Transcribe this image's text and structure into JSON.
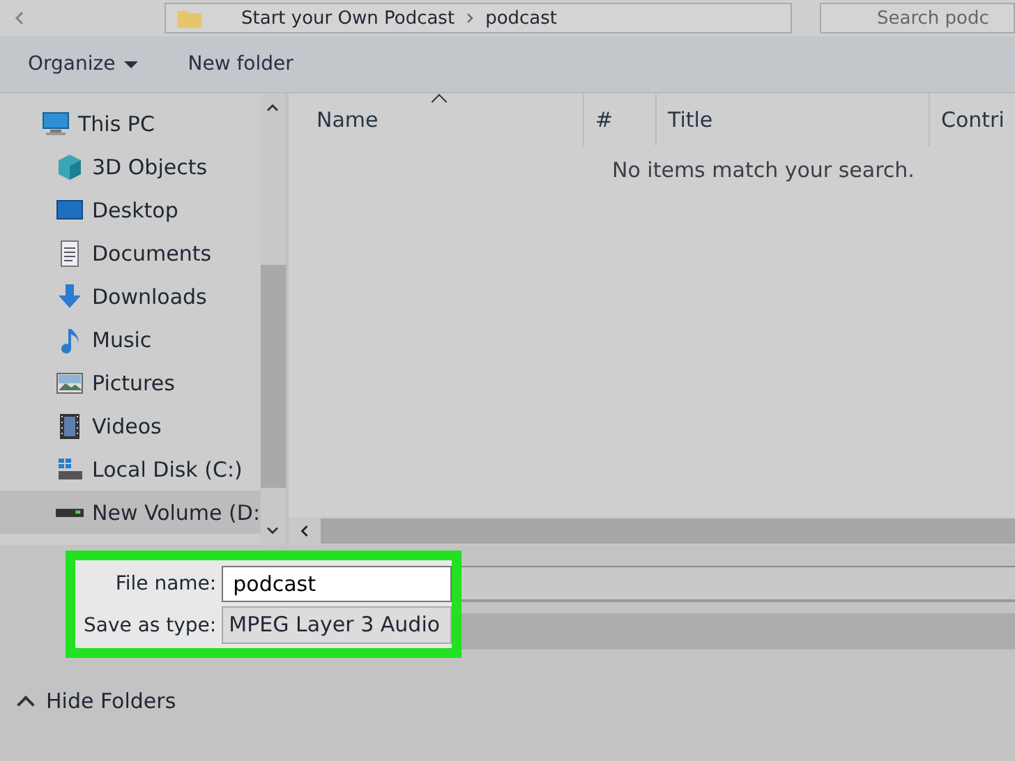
{
  "address_bar": {
    "path": [
      "Start your Own Podcast",
      "podcast"
    ],
    "search_placeholder": "Search podc"
  },
  "toolbar": {
    "organize": "Organize",
    "new_folder": "New folder"
  },
  "sidebar": {
    "items": [
      {
        "label": "This PC",
        "kind": "pc",
        "selected": false,
        "children": [
          {
            "label": "3D Objects",
            "kind": "cube",
            "selected": false
          },
          {
            "label": "Desktop",
            "kind": "desktop",
            "selected": false
          },
          {
            "label": "Documents",
            "kind": "documents",
            "selected": false
          },
          {
            "label": "Downloads",
            "kind": "downloads",
            "selected": false
          },
          {
            "label": "Music",
            "kind": "music",
            "selected": false
          },
          {
            "label": "Pictures",
            "kind": "pictures",
            "selected": false
          },
          {
            "label": "Videos",
            "kind": "videos",
            "selected": false
          },
          {
            "label": "Local Disk (C:)",
            "kind": "disk",
            "selected": false
          },
          {
            "label": "New Volume (D:",
            "kind": "drive",
            "selected": true
          }
        ]
      }
    ]
  },
  "table": {
    "columns": [
      "Name",
      "#",
      "Title",
      "Contri"
    ],
    "empty_message": "No items match your search."
  },
  "save_form": {
    "file_name_label": "File name:",
    "file_name": "podcast",
    "type_label": "Save as type:",
    "type": "MPEG Layer 3 Audio"
  },
  "footer": {
    "hide_folders": "Hide Folders"
  }
}
